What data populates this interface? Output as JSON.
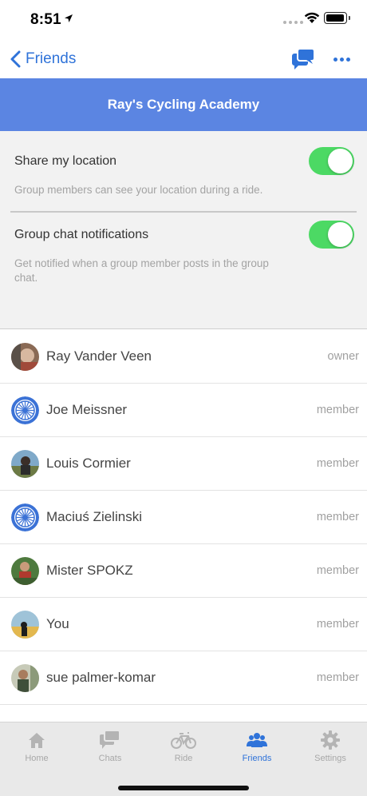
{
  "status_bar": {
    "time": "8:51"
  },
  "nav": {
    "back_label": "Friends",
    "chat_icon": "chat-bubbles-icon",
    "more_icon": "more-dots-icon",
    "accent_color": "#2f73d9"
  },
  "group": {
    "title": "Ray's Cycling Academy",
    "header_color": "#5b85e2"
  },
  "settings": {
    "share_location": {
      "label": "Share my location",
      "description": "Group members can see your location during a ride.",
      "enabled": true
    },
    "chat_notifications": {
      "label": "Group chat notifications",
      "description": "Get notified when a group member posts in the group chat.",
      "enabled": true
    },
    "toggle_color": "#4cd964"
  },
  "members": [
    {
      "name": "Ray Vander Veen",
      "role": "owner",
      "avatar": "photo"
    },
    {
      "name": "Joe Meissner",
      "role": "member",
      "avatar": "wheel-placeholder-icon"
    },
    {
      "name": "Louis Cormier",
      "role": "member",
      "avatar": "photo"
    },
    {
      "name": "Maciuś Zielinski",
      "role": "member",
      "avatar": "wheel-placeholder-icon"
    },
    {
      "name": "Mister SPOKZ",
      "role": "member",
      "avatar": "photo"
    },
    {
      "name": "You",
      "role": "member",
      "avatar": "photo"
    },
    {
      "name": "sue palmer-komar",
      "role": "member",
      "avatar": "photo"
    }
  ],
  "tabs": [
    {
      "label": "Home",
      "icon": "home-icon",
      "active": false
    },
    {
      "label": "Chats",
      "icon": "chats-icon",
      "active": false
    },
    {
      "label": "Ride",
      "icon": "bicycle-icon",
      "active": false
    },
    {
      "label": "Friends",
      "icon": "friends-icon",
      "active": true
    },
    {
      "label": "Settings",
      "icon": "gear-icon",
      "active": false
    }
  ]
}
